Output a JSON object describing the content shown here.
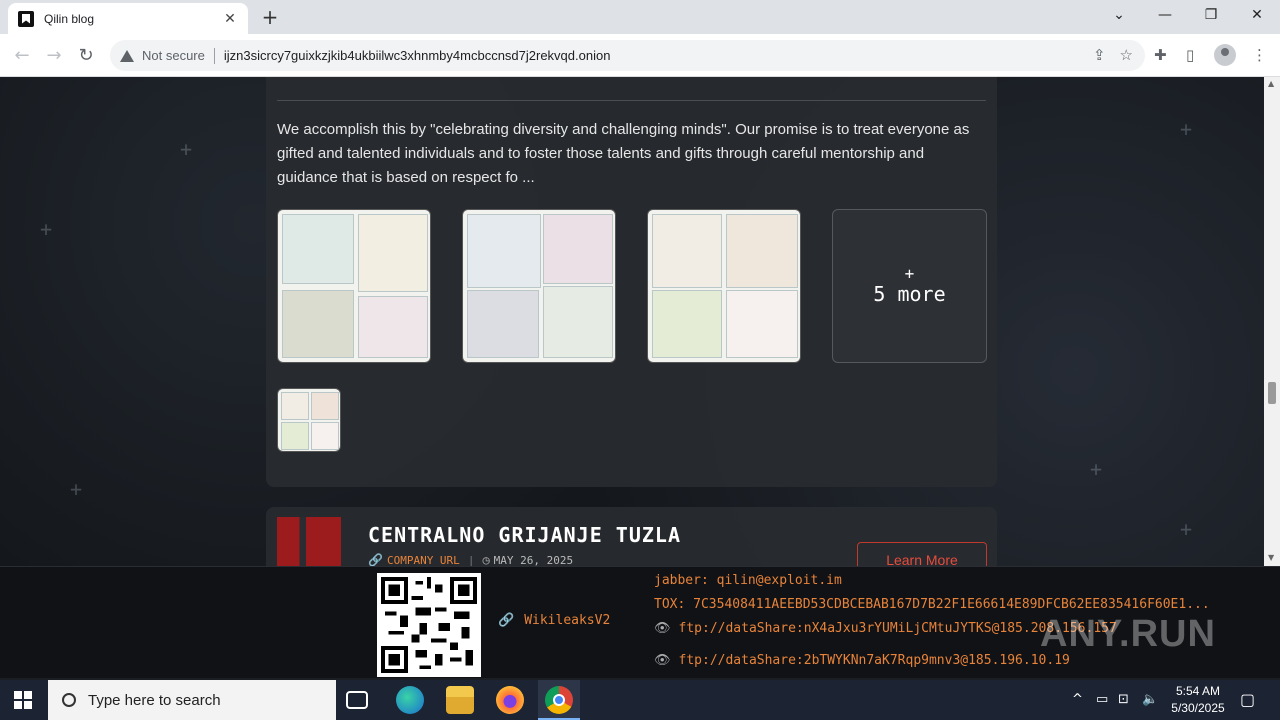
{
  "browser": {
    "tab_title": "Qilin blog",
    "tab_close": "✕",
    "new_tab": "+",
    "win_min": "—",
    "win_max": "❐",
    "win_close": "✕",
    "win_dropdown": "⌄",
    "not_secure": "Not secure",
    "url": "ijzn3sicrcy7guixkzjkib4ukbiilwc3xhnmby4mcbccnsd7j2rekvqd.onion"
  },
  "post": {
    "description": "We accomplish this by \"celebrating diversity and challenging minds\". Our promise is to treat everyone as gifted and talented individuals and to foster those talents and gifts through careful mentorship and guidance that is based on respect fo ...",
    "more_plus": "+",
    "more_label": "5 more"
  },
  "next_post": {
    "company": "CENTRALNO GRIJANJE TUZLA",
    "company_url_label": "COMPANY URL",
    "date": "MAY 26, 2025",
    "learn_more": "Learn More"
  },
  "footer": {
    "wiki": "WikileaksV2",
    "jabber": "jabber: qilin@exploit.im",
    "tox": "TOX: 7C35408411AEEBD53CDBCEBAB167D7B22F1E66614E89DFCB62EE835416F60E1...",
    "ftp1": "ftp://dataShare:nX4aJxu3rYUMiLjCMtuJYTKS@185.208.156.157",
    "ftp2": "ftp://dataShare:2bTWYKNn7aK7Rqp9mnv3@185.196.10.19",
    "watermark": "ANY.RUN"
  },
  "taskbar": {
    "search_placeholder": "Type here to search",
    "time": "5:54 AM",
    "date": "5/30/2025"
  },
  "colors": {
    "accent_orange": "#e8833a",
    "learn_red": "#e74c3c"
  }
}
